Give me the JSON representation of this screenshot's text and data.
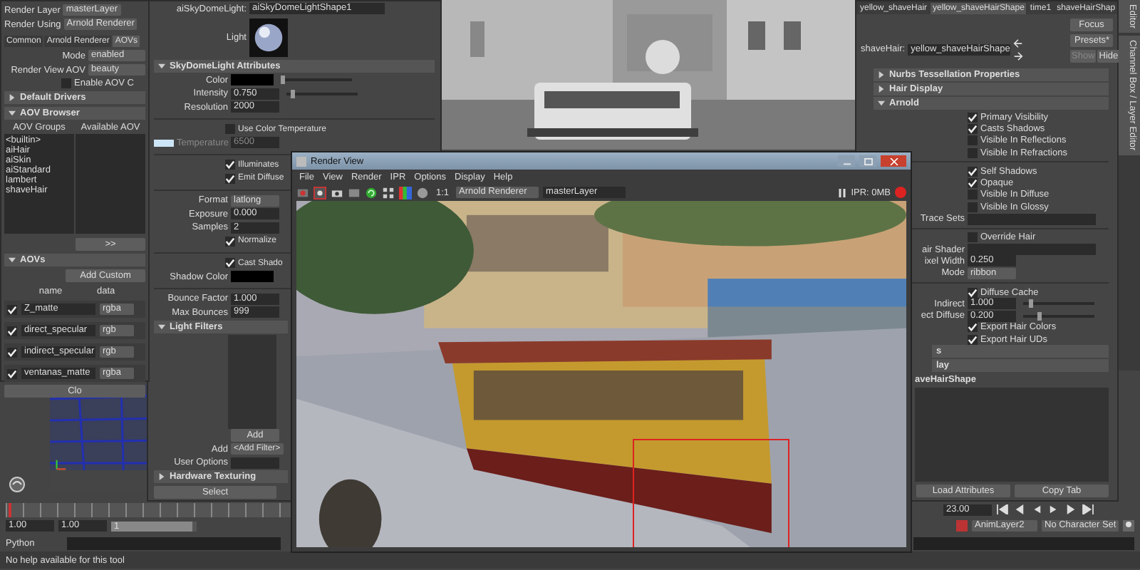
{
  "render_settings": {
    "fields": [
      {
        "label": "Render Layer",
        "value": "masterLayer"
      },
      {
        "label": "Render Using",
        "value": "Arnold Renderer"
      }
    ],
    "tabs": [
      {
        "label": "Common",
        "selected": false
      },
      {
        "label": "Arnold Renderer",
        "selected": false
      },
      {
        "label": "AOVs",
        "selected": true
      }
    ],
    "options": [
      {
        "label": "Mode",
        "value": "enabled"
      },
      {
        "label": "Render View AOV",
        "value": "beauty"
      }
    ],
    "enable_aov": {
      "label": "Enable AOV C",
      "checked": false
    },
    "default_drivers": {
      "title": "Default Drivers",
      "expanded": false
    },
    "aov_browser": {
      "title": "AOV Browser",
      "expanded": true,
      "columns": [
        "AOV Groups",
        "Available AOV"
      ],
      "groups": [
        "<builtin>",
        "aiHair",
        "aiSkin",
        "aiStandard",
        "lambert",
        "shaveHair"
      ],
      "move_button": ">>"
    },
    "aovs": {
      "title": "AOVs",
      "expanded": true,
      "add_button": "Add Custom",
      "columns": [
        "name",
        "data"
      ],
      "rows": [
        {
          "checked": true,
          "name": "Z_matte",
          "data": "rgba"
        },
        {
          "checked": true,
          "name": "direct_specular",
          "data": "rgb"
        },
        {
          "checked": true,
          "name": "indirect_specular",
          "data": "rgb"
        },
        {
          "checked": true,
          "name": "ventanas_matte",
          "data": "rgba"
        }
      ]
    },
    "close_button": "Clo"
  },
  "attribute_editor": {
    "node": {
      "label": "aiSkyDomeLight:",
      "value": "aiSkyDomeLightShape1"
    },
    "swatch_label": "Light",
    "section": {
      "title": "SkyDomeLight Attributes",
      "expanded": true
    },
    "rows": [
      {
        "kind": "color",
        "label": "Color",
        "level": 0.0
      },
      {
        "kind": "slider",
        "label": "Intensity",
        "value": "0.750",
        "level": 0.05
      },
      {
        "kind": "number",
        "label": "Resolution",
        "value": "2000"
      },
      {
        "kind": "divider"
      },
      {
        "kind": "checkbox",
        "label": "Use Color Temperature",
        "checked": false
      },
      {
        "kind": "temperature",
        "label": "Temperature",
        "value": "6500",
        "disabled": true
      },
      {
        "kind": "divider"
      },
      {
        "kind": "checkbox",
        "label": "Illuminates",
        "checked": true
      },
      {
        "kind": "checkbox",
        "label": "Emit Diffuse",
        "checked": true
      },
      {
        "kind": "divider"
      },
      {
        "kind": "dropdown",
        "label": "Format",
        "value": "latlong"
      },
      {
        "kind": "number",
        "label": "Exposure",
        "value": "0.000"
      },
      {
        "kind": "number",
        "label": "Samples",
        "value": "2"
      },
      {
        "kind": "checkbox",
        "label": "Normalize",
        "checked": true
      },
      {
        "kind": "divider"
      },
      {
        "kind": "checkbox",
        "label": "Cast Shado",
        "checked": true
      },
      {
        "kind": "color",
        "label": "Shadow Color"
      },
      {
        "kind": "divider"
      },
      {
        "kind": "number",
        "label": "Bounce Factor",
        "value": "1.000"
      },
      {
        "kind": "number",
        "label": "Max Bounces",
        "value": "999"
      }
    ],
    "light_filters": {
      "title": "Light Filters",
      "expanded": true,
      "add_button": "Add",
      "add_label": "Add",
      "add_value": "<Add Filter>",
      "user_options": "User Options"
    },
    "hardware": {
      "title": "Hardware Texturing",
      "expanded": false
    },
    "select_button": "Select"
  },
  "render_view": {
    "title": "Render View",
    "menu": [
      "File",
      "View",
      "Render",
      "IPR",
      "Options",
      "Display",
      "Help"
    ],
    "ratio": "1:1",
    "renderer": "Arnold Renderer",
    "layer": "masterLayer",
    "ipr_status": "IPR: 0MB"
  },
  "hair_editor": {
    "tabs": [
      {
        "label": "yellow_shaveHair",
        "selected": false
      },
      {
        "label": "yellow_shaveHairShape",
        "selected": true
      },
      {
        "label": "time1",
        "selected": false
      },
      {
        "label": "shaveHairShap",
        "selected": false
      }
    ],
    "node": {
      "label": "shaveHair:",
      "value": "yellow_shaveHairShape"
    },
    "buttons": [
      {
        "label": "Focus",
        "disabled": false
      },
      {
        "label": "Presets*",
        "disabled": false
      },
      {
        "label": "Show",
        "disabled": true
      },
      {
        "label": "Hide",
        "disabled": false
      }
    ],
    "sections": [
      {
        "title": "Nurbs Tessellation Properties",
        "expanded": false
      },
      {
        "title": "Hair Display",
        "expanded": false
      },
      {
        "title": "Arnold",
        "expanded": true
      }
    ],
    "rows": [
      {
        "kind": "checkbox",
        "label": "Primary Visibility",
        "checked": true
      },
      {
        "kind": "checkbox",
        "label": "Casts Shadows",
        "checked": true
      },
      {
        "kind": "checkbox",
        "label": "Visible In Reflections",
        "checked": false
      },
      {
        "kind": "checkbox",
        "label": "Visible In Refractions",
        "checked": false
      },
      {
        "kind": "divider"
      },
      {
        "kind": "checkbox",
        "label": "Self Shadows",
        "checked": true
      },
      {
        "kind": "checkbox",
        "label": "Opaque",
        "checked": true
      },
      {
        "kind": "checkbox",
        "label": "Visible In Diffuse",
        "checked": false
      },
      {
        "kind": "checkbox",
        "label": "Visible In Glossy",
        "checked": false
      },
      {
        "kind": "field",
        "label": "Trace Sets"
      },
      {
        "kind": "divider"
      },
      {
        "kind": "checkbox",
        "label": "Override Hair",
        "checked": false
      },
      {
        "kind": "field",
        "label": "air Shader"
      },
      {
        "kind": "number",
        "label": "ixel Width",
        "value": "0.250"
      },
      {
        "kind": "dropdown",
        "label": "Mode",
        "value": "ribbon"
      },
      {
        "kind": "divider"
      },
      {
        "kind": "checkbox",
        "label": "Diffuse Cache",
        "checked": true
      },
      {
        "kind": "slider",
        "label": "Indirect",
        "value": "1.000",
        "level": 0.08
      },
      {
        "kind": "slider",
        "label": "ect Diffuse",
        "value": "0.200",
        "level": 0.2
      },
      {
        "kind": "checkbox",
        "label": "Export Hair Colors",
        "checked": true
      },
      {
        "kind": "checkbox",
        "label": "Export Hair UDs",
        "checked": true
      }
    ],
    "lower_sections": [
      "s",
      "lay"
    ],
    "shape_heading": "aveHairShape",
    "bottom_buttons": [
      "Load Attributes",
      "Copy Tab"
    ]
  },
  "side_tabs": [
    "Editor",
    "Channel Box / Layer Editor"
  ],
  "time_controls": {
    "level": 0.01,
    "start": "1.00",
    "start_range": "1.00",
    "range": {
      "label": "1",
      "level": 0.95
    },
    "end": "23.00",
    "anim_layer": "AnimLayer2",
    "character_set": "No Character Set"
  },
  "command_line": {
    "label": "Python"
  },
  "help_line": "No help available for this tool"
}
